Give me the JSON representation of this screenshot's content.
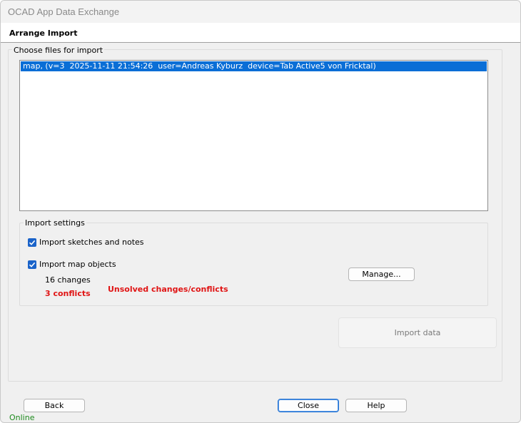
{
  "window": {
    "title": "OCAD App Data Exchange"
  },
  "header": {
    "heading": "Arrange Import"
  },
  "files": {
    "legend": "Choose files for import",
    "items": [
      {
        "label": "map, (v=3  2025-11-11 21:54:26  user=Andreas Kyburz  device=Tab Active5 von Fricktal)",
        "selected": true
      }
    ]
  },
  "import_settings": {
    "legend": "Import settings",
    "sketches": {
      "label": "Import sketches and notes",
      "checked": true
    },
    "map_objects": {
      "label": "Import map objects",
      "checked": true
    },
    "changes_text": "16 changes",
    "conflicts_text": "3 conflicts",
    "warning_text": "Unsolved changes/conflicts",
    "manage_label": "Manage..."
  },
  "actions": {
    "import_label": "Import data",
    "back_label": "Back",
    "close_label": "Close",
    "help_label": "Help"
  },
  "status": {
    "text": "Online"
  },
  "colors": {
    "selection": "#0a6ed6",
    "checkbox": "#1a63c9",
    "conflict_red": "#e01414",
    "online_green": "#1d8a1d"
  }
}
